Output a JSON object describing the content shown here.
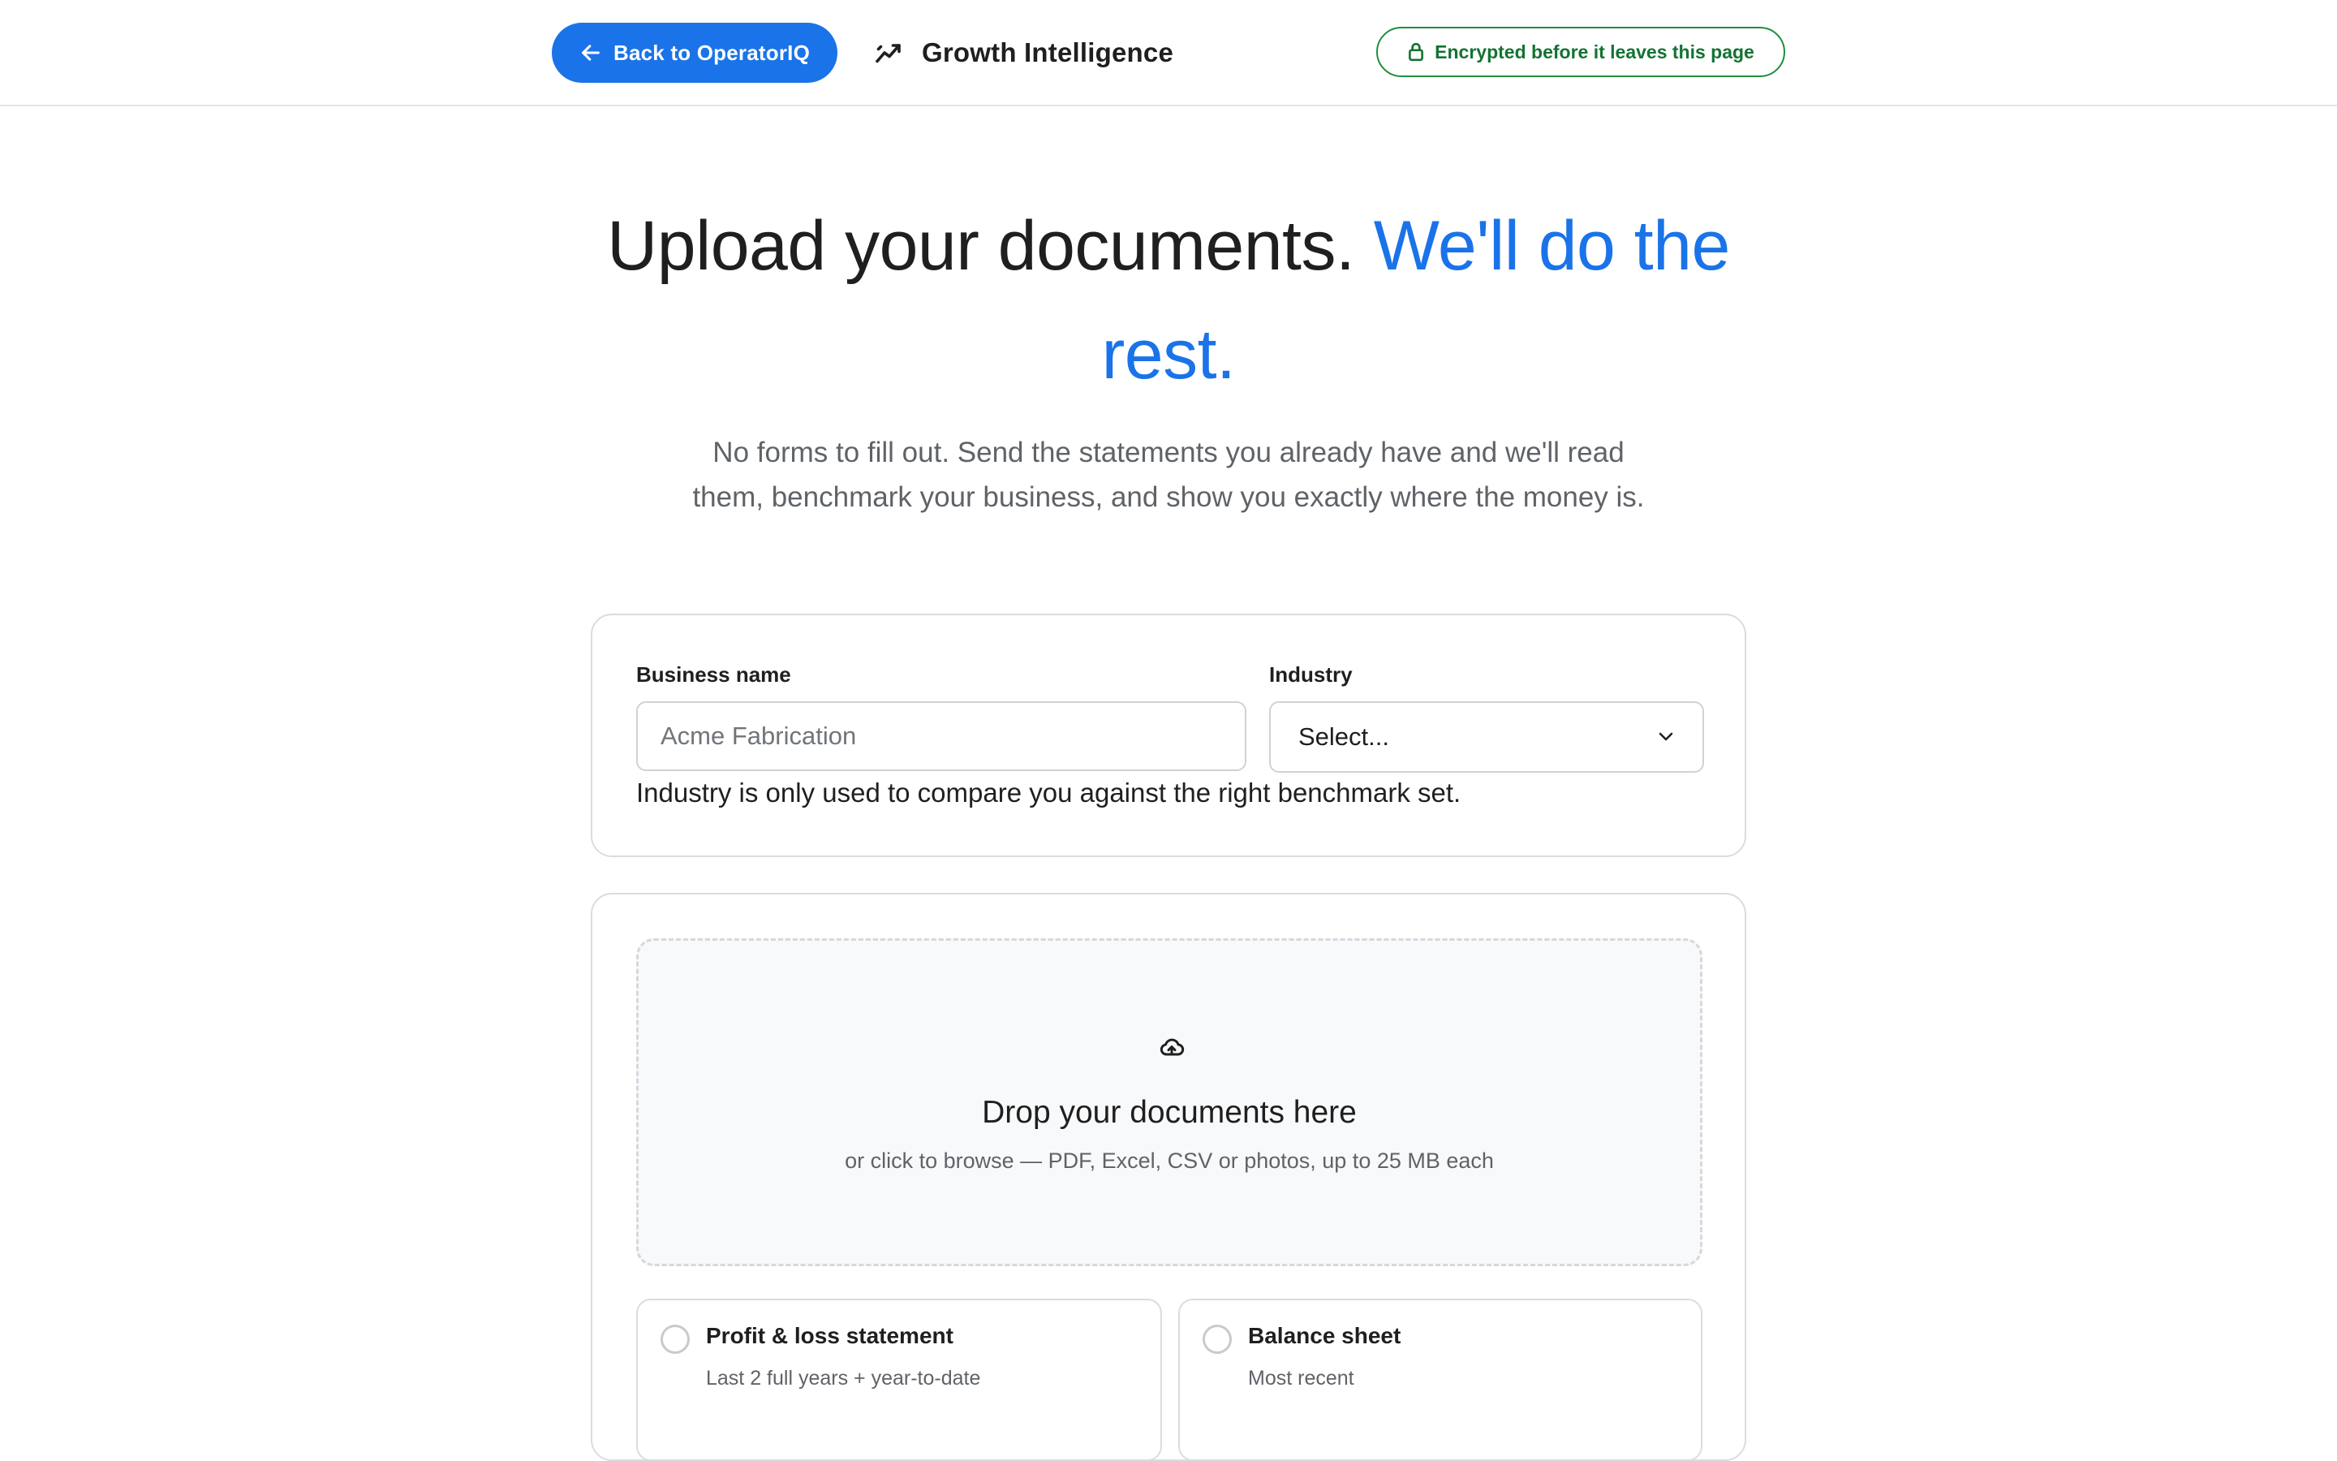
{
  "header": {
    "back_label": "Back to OperatorIQ",
    "brand_name": "Growth Intelligence",
    "encryption_badge": "Encrypted before it leaves this page",
    "icons": {
      "back": "arrow-left-icon",
      "brand": "trend-chart-icon",
      "badge": "lock-icon"
    }
  },
  "hero": {
    "title_plain": "Upload your documents.",
    "title_accent": "We'll do the rest.",
    "subtitle": "No forms to fill out. Send the statements you already have and we'll read them, benchmark your business, and show you exactly where the money is."
  },
  "business_form": {
    "business_name_label": "Business name",
    "business_name_placeholder": "Acme Fabrication",
    "industry_label": "Industry",
    "industry_selected": "Select...",
    "industry_helper": "Industry is only used to compare you against the right benchmark set."
  },
  "upload": {
    "drop_icon": "cloud-upload-icon",
    "drop_title": "Drop your documents here",
    "drop_subtitle": "or click to browse — PDF, Excel, CSV or photos, up to 25 MB each",
    "document_types": [
      {
        "title": "Profit & loss statement",
        "subtitle": "Last 2 full years + year-to-date"
      },
      {
        "title": "Balance sheet",
        "subtitle": "Most recent"
      }
    ]
  },
  "colors": {
    "accent": "#1a73e8",
    "badge_green": "#137333",
    "border": "#dadce0",
    "muted_text": "#5f6368"
  }
}
